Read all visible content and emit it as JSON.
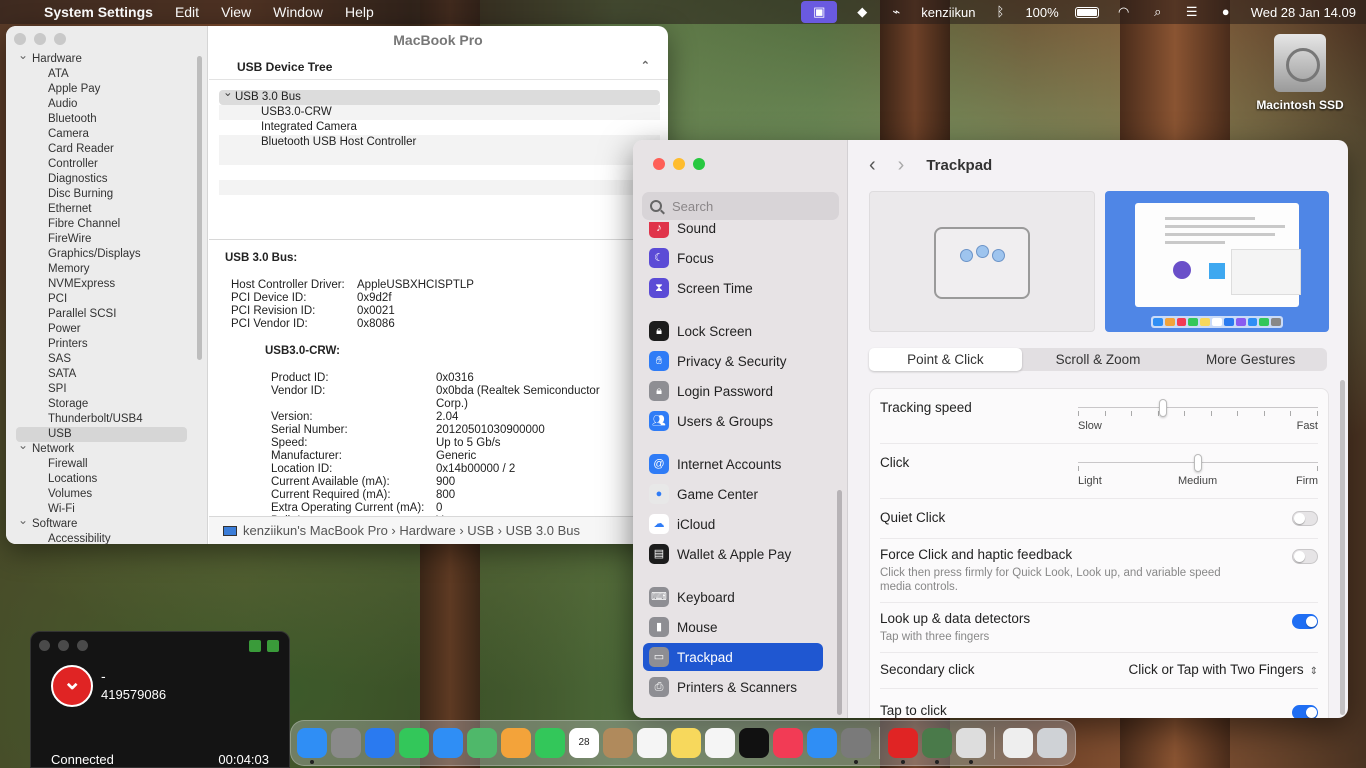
{
  "menubar": {
    "app_name": "System Settings",
    "menus": [
      "Edit",
      "View",
      "Window",
      "Help"
    ],
    "user": "kenziikun",
    "battery": "100%",
    "datetime": "Wed 28 Jan  14.09"
  },
  "desktop": {
    "disk_label": "Macintosh SSD"
  },
  "sysinfo": {
    "title": "MacBook Pro",
    "sidebar": [
      {
        "label": "Hardware",
        "type": "group"
      },
      {
        "label": "ATA",
        "type": "child"
      },
      {
        "label": "Apple Pay",
        "type": "child"
      },
      {
        "label": "Audio",
        "type": "child"
      },
      {
        "label": "Bluetooth",
        "type": "child"
      },
      {
        "label": "Camera",
        "type": "child"
      },
      {
        "label": "Card Reader",
        "type": "child"
      },
      {
        "label": "Controller",
        "type": "child"
      },
      {
        "label": "Diagnostics",
        "type": "child"
      },
      {
        "label": "Disc Burning",
        "type": "child"
      },
      {
        "label": "Ethernet",
        "type": "child"
      },
      {
        "label": "Fibre Channel",
        "type": "child"
      },
      {
        "label": "FireWire",
        "type": "child"
      },
      {
        "label": "Graphics/Displays",
        "type": "child"
      },
      {
        "label": "Memory",
        "type": "child"
      },
      {
        "label": "NVMExpress",
        "type": "child"
      },
      {
        "label": "PCI",
        "type": "child"
      },
      {
        "label": "Parallel SCSI",
        "type": "child"
      },
      {
        "label": "Power",
        "type": "child"
      },
      {
        "label": "Printers",
        "type": "child"
      },
      {
        "label": "SAS",
        "type": "child"
      },
      {
        "label": "SATA",
        "type": "child"
      },
      {
        "label": "SPI",
        "type": "child"
      },
      {
        "label": "Storage",
        "type": "child"
      },
      {
        "label": "Thunderbolt/USB4",
        "type": "child"
      },
      {
        "label": "USB",
        "type": "child",
        "selected": true
      },
      {
        "label": "Network",
        "type": "group"
      },
      {
        "label": "Firewall",
        "type": "child"
      },
      {
        "label": "Locations",
        "type": "child"
      },
      {
        "label": "Volumes",
        "type": "child"
      },
      {
        "label": "Wi-Fi",
        "type": "child"
      },
      {
        "label": "Software",
        "type": "group"
      },
      {
        "label": "Accessibility",
        "type": "child"
      }
    ],
    "tree_header": "USB Device Tree",
    "tree": [
      {
        "label": "USB 3.0 Bus",
        "type": "bus"
      },
      {
        "label": "USB3.0-CRW",
        "type": "device"
      },
      {
        "label": "Integrated Camera",
        "type": "device"
      },
      {
        "label": "Bluetooth USB Host Controller",
        "type": "device"
      }
    ],
    "detail_title": "USB 3.0 Bus:",
    "bus_props": [
      {
        "k": "Host Controller Driver:",
        "v": "AppleUSBXHCISPTLP"
      },
      {
        "k": "PCI Device ID:",
        "v": "0x9d2f"
      },
      {
        "k": "PCI Revision ID:",
        "v": "0x0021"
      },
      {
        "k": "PCI Vendor ID:",
        "v": "0x8086"
      }
    ],
    "device_title": "USB3.0-CRW:",
    "device_props": [
      {
        "k": "Product ID:",
        "v": "0x0316"
      },
      {
        "k": "Vendor ID:",
        "v": "0x0bda  (Realtek Semiconductor Corp.)"
      },
      {
        "k": "Version:",
        "v": "2.04"
      },
      {
        "k": "Serial Number:",
        "v": "20120501030900000"
      },
      {
        "k": "Speed:",
        "v": "Up to 5 Gb/s"
      },
      {
        "k": "Manufacturer:",
        "v": "Generic"
      },
      {
        "k": "Location ID:",
        "v": "0x14b00000 / 2"
      },
      {
        "k": "Current Available (mA):",
        "v": "900"
      },
      {
        "k": "Current Required (mA):",
        "v": "800"
      },
      {
        "k": "Extra Operating Current (mA):",
        "v": "0"
      },
      {
        "k": "Built-In:",
        "v": "Yes"
      }
    ],
    "path": "kenziikun's MacBook Pro › Hardware › USB › USB 3.0 Bus"
  },
  "settings": {
    "search_placeholder": "Search",
    "title": "Trackpad",
    "sidebar": [
      {
        "label": "Sound",
        "color": "#e0344a",
        "icon": "speaker-icon"
      },
      {
        "label": "Focus",
        "color": "#5b4bd6",
        "icon": "moon-icon"
      },
      {
        "label": "Screen Time",
        "color": "#5b4bd6",
        "icon": "hourglass-icon"
      },
      {
        "label": "Lock Screen",
        "color": "#1c1c1c",
        "icon": "lock-icon"
      },
      {
        "label": "Privacy & Security",
        "color": "#2f7cf6",
        "icon": "hand-icon"
      },
      {
        "label": "Login Password",
        "color": "#8e8e93",
        "icon": "lock-icon"
      },
      {
        "label": "Users & Groups",
        "color": "#2f7cf6",
        "icon": "users-icon"
      },
      {
        "label": "Internet Accounts",
        "color": "#2f7cf6",
        "icon": "at-icon"
      },
      {
        "label": "Game Center",
        "color": "#e8e8e8",
        "icon": "game-center-icon"
      },
      {
        "label": "iCloud",
        "color": "#ffffff",
        "icon": "cloud-icon"
      },
      {
        "label": "Wallet & Apple Pay",
        "color": "#1c1c1c",
        "icon": "wallet-icon"
      },
      {
        "label": "Keyboard",
        "color": "#8e8e93",
        "icon": "keyboard-icon"
      },
      {
        "label": "Mouse",
        "color": "#8e8e93",
        "icon": "mouse-icon"
      },
      {
        "label": "Trackpad",
        "color": "#8e8e93",
        "icon": "trackpad-icon",
        "selected": true
      },
      {
        "label": "Printers & Scanners",
        "color": "#8e8e93",
        "icon": "printer-icon"
      }
    ],
    "tabs": [
      "Point & Click",
      "Scroll & Zoom",
      "More Gestures"
    ],
    "active_tab": "Point & Click",
    "tracking_speed": {
      "label": "Tracking speed",
      "min_label": "Slow",
      "max_label": "Fast",
      "value": 0.35
    },
    "click": {
      "label": "Click",
      "min_label": "Light",
      "mid_label": "Medium",
      "max_label": "Firm",
      "value": 0.5
    },
    "quiet_click": {
      "label": "Quiet Click",
      "on": false
    },
    "force_click": {
      "label": "Force Click and haptic feedback",
      "desc": "Click then press firmly for Quick Look, Look up, and variable speed media controls.",
      "on": false
    },
    "lookup": {
      "label": "Look up & data detectors",
      "desc": "Tap with three fingers",
      "on": true
    },
    "secondary_click": {
      "label": "Secondary click",
      "value": "Click or Tap with Two Fingers"
    },
    "tap_to_click": {
      "label": "Tap to click",
      "on": true
    }
  },
  "call": {
    "name": "-",
    "number": "419579086",
    "status": "Connected",
    "timer": "00:04:03"
  },
  "dock": {
    "apps": [
      {
        "name": "finder",
        "color": "#2f8ef5"
      },
      {
        "name": "launchpad",
        "color": "#8a8a8a"
      },
      {
        "name": "safari",
        "color": "#2a7af0"
      },
      {
        "name": "messages",
        "color": "#33c75a"
      },
      {
        "name": "mail",
        "color": "#2f8ef5"
      },
      {
        "name": "maps",
        "color": "#4fb86a"
      },
      {
        "name": "photos",
        "color": "#f3a33a"
      },
      {
        "name": "facetime",
        "color": "#33c75a"
      },
      {
        "name": "calendar",
        "color": "#ffffff",
        "text": "28"
      },
      {
        "name": "contacts",
        "color": "#b08a5c"
      },
      {
        "name": "reminders",
        "color": "#f5f5f5"
      },
      {
        "name": "notes",
        "color": "#f7d85c"
      },
      {
        "name": "freeform",
        "color": "#f5f5f5"
      },
      {
        "name": "tv",
        "color": "#111111"
      },
      {
        "name": "music",
        "color": "#f23b55"
      },
      {
        "name": "app-store",
        "color": "#2f8ef5"
      },
      {
        "name": "system-settings",
        "color": "#7a7a7a"
      },
      {
        "name": "anydesk",
        "color": "#e02424"
      },
      {
        "name": "system-information",
        "color": "#4a7a4a"
      },
      {
        "name": "utility",
        "color": "#dddddd"
      },
      {
        "name": "documents",
        "color": "#eeeeee"
      },
      {
        "name": "trash",
        "color": "#cfd2d6"
      }
    ]
  }
}
